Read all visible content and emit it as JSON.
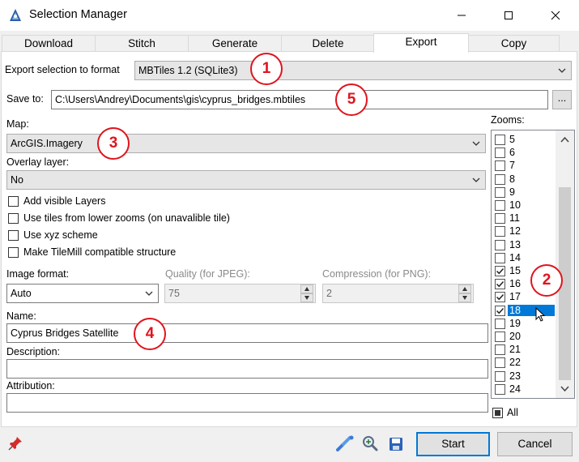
{
  "window": {
    "title": "Selection Manager"
  },
  "tabs": [
    {
      "label": "Download",
      "active": false
    },
    {
      "label": "Stitch",
      "active": false
    },
    {
      "label": "Generate",
      "active": false
    },
    {
      "label": "Delete",
      "active": false
    },
    {
      "label": "Export",
      "active": true
    },
    {
      "label": "Copy",
      "active": false
    }
  ],
  "export_format": {
    "label": "Export selection to format",
    "value": "MBTiles 1.2 (SQLite3)"
  },
  "save_to": {
    "label": "Save to:",
    "value": "C:\\Users\\Andrey\\Documents\\gis\\cyprus_bridges.mbtiles",
    "browse_label": "..."
  },
  "map": {
    "label": "Map:",
    "value": "ArcGIS.Imagery"
  },
  "overlay": {
    "label": "Overlay layer:",
    "value": "No"
  },
  "options": [
    {
      "label": "Add visible Layers",
      "checked": false
    },
    {
      "label": "Use tiles from lower zooms (on unavalible tile)",
      "checked": false
    },
    {
      "label": "Use xyz scheme",
      "checked": false
    },
    {
      "label": "Make TileMill compatible structure",
      "checked": false
    }
  ],
  "image_format": {
    "label": "Image format:",
    "value": "Auto"
  },
  "quality": {
    "label": "Quality (for JPEG):",
    "value": "75"
  },
  "compression": {
    "label": "Compression (for PNG):",
    "value": "2"
  },
  "name": {
    "label": "Name:",
    "value": "Cyprus Bridges Satellite"
  },
  "description": {
    "label": "Description:",
    "value": ""
  },
  "attribution": {
    "label": "Attribution:",
    "value": ""
  },
  "zooms": {
    "label": "Zooms:",
    "items": [
      {
        "label": "5",
        "checked": false
      },
      {
        "label": "6",
        "checked": false
      },
      {
        "label": "7",
        "checked": false
      },
      {
        "label": "8",
        "checked": false
      },
      {
        "label": "9",
        "checked": false
      },
      {
        "label": "10",
        "checked": false
      },
      {
        "label": "11",
        "checked": false
      },
      {
        "label": "12",
        "checked": false
      },
      {
        "label": "13",
        "checked": false
      },
      {
        "label": "14",
        "checked": false
      },
      {
        "label": "15",
        "checked": true
      },
      {
        "label": "16",
        "checked": true
      },
      {
        "label": "17",
        "checked": true
      },
      {
        "label": "18",
        "checked": true,
        "selected": true
      },
      {
        "label": "19",
        "checked": false
      },
      {
        "label": "20",
        "checked": false
      },
      {
        "label": "21",
        "checked": false
      },
      {
        "label": "22",
        "checked": false
      },
      {
        "label": "23",
        "checked": false
      },
      {
        "label": "24",
        "checked": false
      }
    ],
    "all_label": "All",
    "all_state": "indeterminate"
  },
  "markers": [
    "1",
    "2",
    "3",
    "4",
    "5"
  ],
  "footer": {
    "start_label": "Start",
    "cancel_label": "Cancel"
  },
  "colors": {
    "accent": "#0078d7",
    "marker": "#e0141e"
  }
}
